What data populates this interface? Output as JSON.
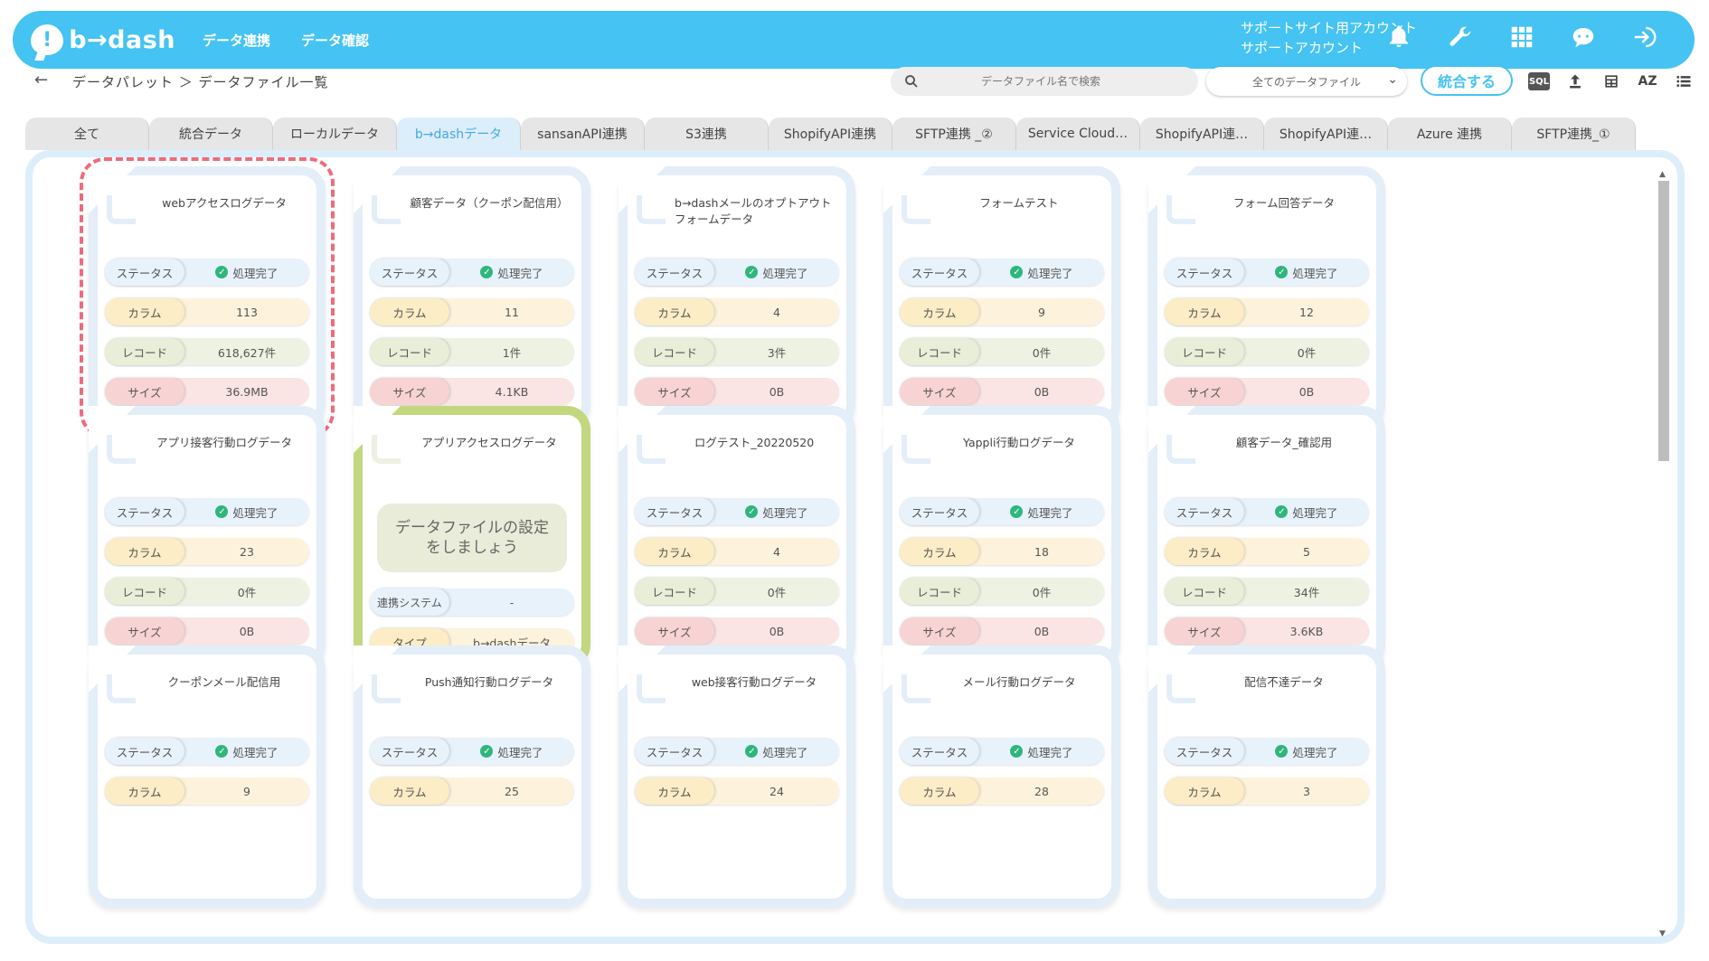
{
  "app": {
    "logo_text": "b→dash",
    "logo_mark": "!",
    "nav": [
      "データ連携",
      "データ確認"
    ],
    "account_line1": "サポートサイト用アカウント",
    "account_line2": "サポートアカウント",
    "icons": [
      "bell-icon",
      "wrench-icon",
      "grid-icon",
      "support-icon",
      "logout-icon"
    ]
  },
  "subbar": {
    "back": "←",
    "breadcrumb": "データパレット ＞ データファイル一覧",
    "search_placeholder": "データファイル名で検索",
    "filter_value": "全てのデータファイル",
    "merge_button": "統合する",
    "sql_label": "SQL",
    "sort_label": "AZ"
  },
  "tabs": [
    {
      "label": "全て",
      "active": false
    },
    {
      "label": "統合データ",
      "active": false
    },
    {
      "label": "ローカルデータ",
      "active": false
    },
    {
      "label": "b→dashデータ",
      "active": true
    },
    {
      "label": "sansanAPI連携",
      "active": false
    },
    {
      "label": "S3連携",
      "active": false
    },
    {
      "label": "ShopifyAPI連携",
      "active": false
    },
    {
      "label": "SFTP連携 _②",
      "active": false
    },
    {
      "label": "Service Cloud…",
      "active": false
    },
    {
      "label": "ShopifyAPI連…",
      "active": false
    },
    {
      "label": "ShopifyAPI連…",
      "active": false
    },
    {
      "label": "Azure 連携",
      "active": false
    },
    {
      "label": "SFTP連携_①",
      "active": false
    }
  ],
  "labels": {
    "status": "ステータス",
    "column": "カラム",
    "record": "レコード",
    "size": "サイズ",
    "done": "処理完了",
    "system": "連携システム",
    "type": "タイプ"
  },
  "cards": [
    {
      "title": "webアクセスログデータ",
      "status": "処理完了",
      "columns": "113",
      "records": "618,627件",
      "size": "36.9MB"
    },
    {
      "title": "顧客データ（クーポン配信用）",
      "status": "処理完了",
      "columns": "11",
      "records": "1件",
      "size": "4.1KB"
    },
    {
      "title": "b→dashメールのオプトアウトフォームデータ",
      "status": "処理完了",
      "columns": "4",
      "records": "3件",
      "size": "0B"
    },
    {
      "title": "フォームテスト",
      "status": "処理完了",
      "columns": "9",
      "records": "0件",
      "size": "0B"
    },
    {
      "title": "フォーム回答データ",
      "status": "処理完了",
      "columns": "12",
      "records": "0件",
      "size": "0B"
    },
    {
      "title": "アプリ接客行動ログデータ",
      "status": "処理完了",
      "columns": "23",
      "records": "0件",
      "size": "0B"
    },
    {
      "title": "アプリアクセスログデータ",
      "setup": "データファイルの設定をしましょう",
      "system": "-",
      "type": "b→dashデータ"
    },
    {
      "title": "ログテスト_20220520",
      "status": "処理完了",
      "columns": "4",
      "records": "0件",
      "size": "0B"
    },
    {
      "title": "Yappli行動ログデータ",
      "status": "処理完了",
      "columns": "18",
      "records": "0件",
      "size": "0B"
    },
    {
      "title": "顧客データ_確認用",
      "status": "処理完了",
      "columns": "5",
      "records": "34件",
      "size": "3.6KB"
    },
    {
      "title": "クーポンメール配信用",
      "status": "処理完了",
      "columns": "9"
    },
    {
      "title": "Push通知行動ログデータ",
      "status": "処理完了",
      "columns": "25"
    },
    {
      "title": "web接客行動ログデータ",
      "status": "処理完了",
      "columns": "24"
    },
    {
      "title": "メール行動ログデータ",
      "status": "処理完了",
      "columns": "28"
    },
    {
      "title": "配信不達データ",
      "status": "処理完了",
      "columns": "3"
    }
  ],
  "colors": {
    "accent": "#45c3f2",
    "selected_dash": "#f06b7a",
    "setup_border": "#c3d77e",
    "done_icon": "#2fb67c"
  }
}
